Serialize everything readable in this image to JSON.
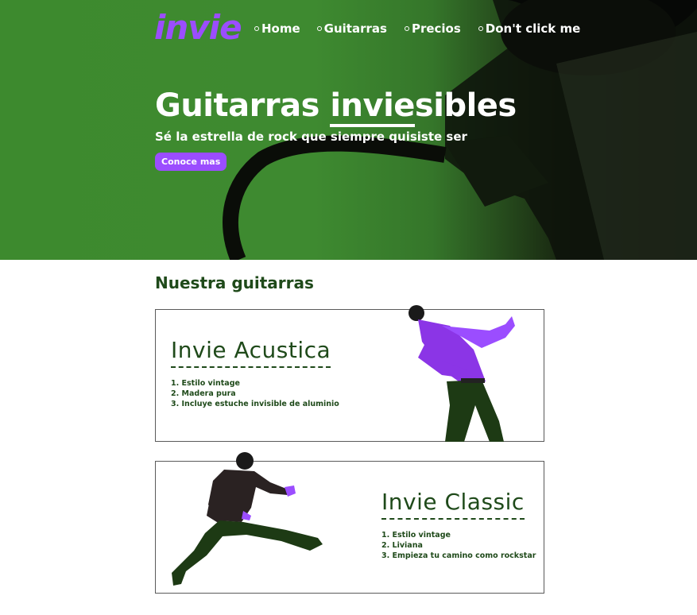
{
  "brand": {
    "logo": "invie",
    "accent": "#9b4dff",
    "green": "#1f4a1a"
  },
  "nav": {
    "items": [
      {
        "label": "Home"
      },
      {
        "label": "Guitarras"
      },
      {
        "label": "Precios"
      },
      {
        "label": "Don't click me"
      }
    ]
  },
  "hero": {
    "title_pre": "Guitarras ",
    "title_underlined": "invie",
    "title_post": "sibles",
    "subtitle": "Sé la estrella de rock que siempre quisiste ser",
    "button": "Conoce mas"
  },
  "section": {
    "title": "Nuestra guitarras",
    "cards": [
      {
        "name": "Invie Acustica",
        "features": [
          "1. Estilo vintage",
          "2. Madera pura",
          "3. Incluye estuche invisible de aluminio"
        ]
      },
      {
        "name": "Invie Classic",
        "features": [
          "1. Estilo vintage",
          "2. Liviana",
          "3. Empieza tu camino como rockstar"
        ]
      }
    ]
  }
}
